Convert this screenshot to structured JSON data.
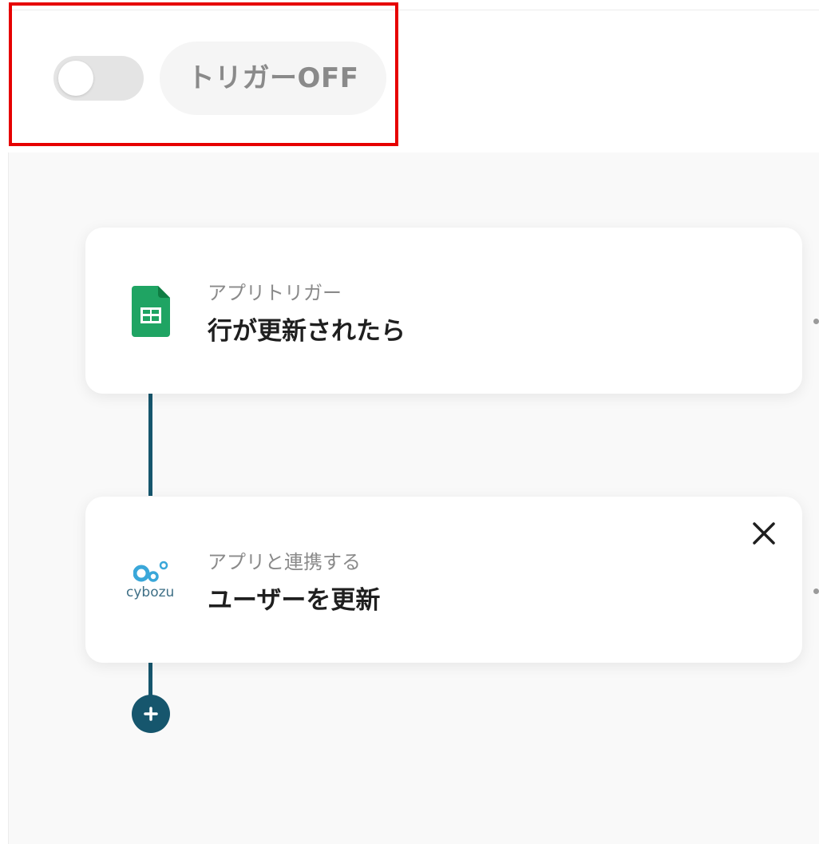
{
  "header": {
    "trigger_toggle_state": "off",
    "trigger_status_label": "トリガーOFF"
  },
  "flow": {
    "steps": [
      {
        "app": "google-sheets",
        "icon": "google-sheets-icon",
        "subtitle": "アプリトリガー",
        "title": "行が更新されたら"
      },
      {
        "app": "cybozu",
        "icon": "cybozu-logo-icon",
        "logo_text": "cybozu",
        "subtitle": "アプリと連携する",
        "title": "ユーザーを更新"
      }
    ]
  },
  "colors": {
    "highlight": "#e60000",
    "connector": "#16566d",
    "sheets_green": "#1fa463",
    "cybozu_blue": "#3aa7d9"
  }
}
